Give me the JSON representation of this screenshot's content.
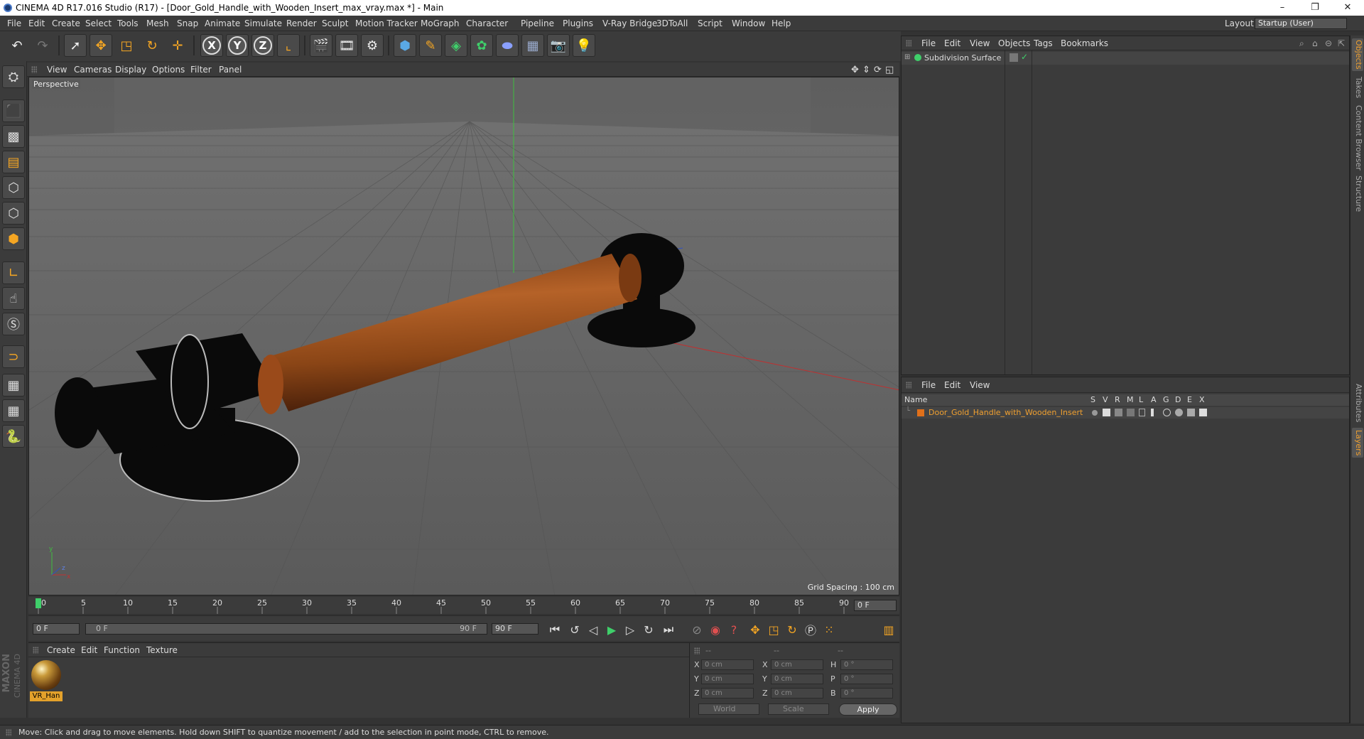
{
  "window": {
    "title": "CINEMA 4D R17.016 Studio (R17) - [Door_Gold_Handle_with_Wooden_Insert_max_vray.max *] - Main",
    "controls": {
      "minimize": "–",
      "restore": "❐",
      "close": "✕"
    }
  },
  "menubar": {
    "items": [
      "File",
      "Edit",
      "Create",
      "Select",
      "Tools",
      "Mesh",
      "Snap",
      "Animate",
      "Simulate",
      "Render",
      "Sculpt",
      "Motion Tracker",
      "MoGraph",
      "Character",
      "Pipeline",
      "Plugins",
      "V-Ray Bridge",
      "3DToAll",
      "Script",
      "Window",
      "Help"
    ],
    "layout_label": "Layout:",
    "layout_value": "Startup (User)"
  },
  "toolbar": {
    "undo_icon": "undo-icon",
    "redo_icon": "redo-icon",
    "axis_x": "X",
    "axis_y": "Y",
    "axis_z": "Z"
  },
  "viewport": {
    "menu": [
      "View",
      "Cameras",
      "Display",
      "Options",
      "Filter",
      "Panel"
    ],
    "camera_label": "Perspective",
    "grid_spacing": "Grid Spacing : 100 cm",
    "axis_labels": {
      "y": "y",
      "x": "x",
      "z": "z"
    }
  },
  "timeline": {
    "ticks": [
      "0",
      "5",
      "10",
      "15",
      "20",
      "25",
      "30",
      "35",
      "40",
      "45",
      "50",
      "55",
      "60",
      "65",
      "70",
      "75",
      "80",
      "85",
      "90"
    ],
    "current_frame_right": "0 F",
    "start_field": "0 F",
    "range_start": "0 F",
    "range_end": "90 F",
    "end_field": "90 F"
  },
  "material_manager": {
    "menu": [
      "Create",
      "Edit",
      "Function",
      "Texture"
    ],
    "materials": [
      {
        "name": "VR_Han"
      }
    ]
  },
  "coordinates": {
    "header": [
      "--",
      "--",
      "--"
    ],
    "rows": [
      {
        "l1": "X",
        "v1": "0 cm",
        "l2": "X",
        "v2": "0 cm",
        "l3": "H",
        "v3": "0 °"
      },
      {
        "l1": "Y",
        "v1": "0 cm",
        "l2": "Y",
        "v2": "0 cm",
        "l3": "P",
        "v3": "0 °"
      },
      {
        "l1": "Z",
        "v1": "0 cm",
        "l2": "Z",
        "v2": "0 cm",
        "l3": "B",
        "v3": "0 °"
      }
    ],
    "mode_world": "World",
    "mode_scale": "Scale",
    "apply_label": "Apply"
  },
  "object_manager": {
    "menu": [
      "File",
      "Edit",
      "View",
      "Objects",
      "Tags",
      "Bookmarks"
    ],
    "objects": [
      {
        "name": "Subdivision Surface",
        "check": "✓"
      }
    ]
  },
  "layer_manager": {
    "menu": [
      "File",
      "Edit",
      "View"
    ],
    "columns": {
      "name": "Name",
      "flags": [
        "S",
        "V",
        "R",
        "M",
        "L",
        "A",
        "G",
        "D",
        "E",
        "X"
      ]
    },
    "layers": [
      {
        "name": "Door_Gold_Handle_with_Wooden_Insert",
        "color": "#e0701a"
      }
    ]
  },
  "side_tabs": [
    "Objects",
    "Takes",
    "Content Browser",
    "Structure",
    "Attributes",
    "Layers"
  ],
  "status": {
    "text": "Move: Click and drag to move elements. Hold down SHIFT to quantize movement / add to the selection in point mode, CTRL to remove."
  },
  "branding": {
    "maxon": "MAXON",
    "cinema": "CINEMA 4D"
  },
  "colors": {
    "accent": "#f0a030",
    "wood": "#9a4a1a",
    "background": "#333333"
  }
}
